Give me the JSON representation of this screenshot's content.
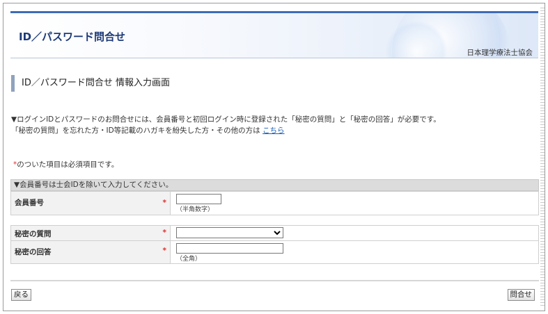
{
  "header": {
    "title": "ID／パスワード問合せ",
    "organization": "日本理学療法士協会"
  },
  "page_heading": "ID／パスワード問合せ 情報入力画面",
  "intro": {
    "line1": "▼ログインIDとパスワードのお問合せには、会員番号と初回ログイン時に登録された「秘密の質問」と「秘密の回答」が必要です。",
    "line2": "「秘密の質問」を忘れた方・ID等記載のハガキを紛失した方・その他の方は",
    "link": "こちら"
  },
  "required_note": {
    "star": "*",
    "text": "のついた項目は必須項目です。"
  },
  "section": {
    "title": "▼会員番号は士会IDを除いて入力してください。"
  },
  "form": {
    "member_number": {
      "label": "会員番号",
      "star": "*",
      "value": "",
      "hint": "（半角数字）"
    },
    "secret_question": {
      "label": "秘密の質問",
      "star": "*",
      "selected": ""
    },
    "secret_answer": {
      "label": "秘密の回答",
      "star": "*",
      "value": "",
      "hint": "（全角）"
    }
  },
  "buttons": {
    "back": "戻る",
    "submit": "問合せ"
  },
  "colors": {
    "header_border": "#3d6bb8",
    "title": "#1d3a78",
    "required_star": "#e03030",
    "link": "#1a5fb4"
  }
}
